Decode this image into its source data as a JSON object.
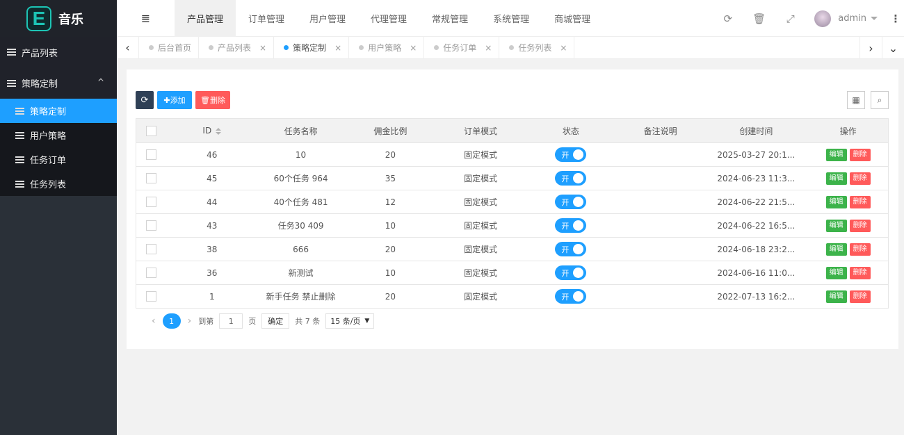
{
  "logo": {
    "letter": "E",
    "title": "音乐"
  },
  "sidebar": {
    "items": [
      {
        "label": "产品列表"
      },
      {
        "label": "策略定制",
        "caret": "^"
      }
    ],
    "sub": [
      {
        "label": "策略定制",
        "active": true
      },
      {
        "label": "用户策略"
      },
      {
        "label": "任务订单"
      },
      {
        "label": "任务列表"
      }
    ]
  },
  "topnav": {
    "menu_icon": "≣",
    "tabs": [
      {
        "label": "产品管理",
        "active": true
      },
      {
        "label": "订单管理"
      },
      {
        "label": "用户管理"
      },
      {
        "label": "代理管理"
      },
      {
        "label": "常规管理"
      },
      {
        "label": "系统管理"
      },
      {
        "label": "商城管理"
      }
    ],
    "refresh_icon": "⟳",
    "trash_icon": "🗑",
    "fullscreen_icon": "⤢",
    "user": "admin",
    "more_icon": "⋮"
  },
  "pagetabs": {
    "left_arrow": "‹",
    "right_arrow": "›",
    "down_arrow": "⌄",
    "close": "×",
    "tabs": [
      {
        "label": "后台首页",
        "closable": false
      },
      {
        "label": "产品列表",
        "closable": true
      },
      {
        "label": "策略定制",
        "closable": true,
        "active": true
      },
      {
        "label": "用户策略",
        "closable": true
      },
      {
        "label": "任务订单",
        "closable": true
      },
      {
        "label": "任务列表",
        "closable": true
      }
    ]
  },
  "toolbar": {
    "refresh": "⟳",
    "add": "✚添加",
    "delete": "🗑删除",
    "cols_icon": "▦",
    "search_icon": "⌕"
  },
  "table": {
    "headers": [
      "ID",
      "任务名称",
      "佣金比例",
      "订单模式",
      "状态",
      "备注说明",
      "创建时间",
      "操作"
    ],
    "switch_label": "开",
    "edit_label": "编辑",
    "delete_label": "删除",
    "rows": [
      {
        "id": "46",
        "name": "10",
        "ratio": "20",
        "mode": "固定模式",
        "note": "",
        "time": "2025-03-27 20:1..."
      },
      {
        "id": "45",
        "name": "60个任务 964",
        "ratio": "35",
        "mode": "固定模式",
        "note": "",
        "time": "2024-06-23 11:3..."
      },
      {
        "id": "44",
        "name": "40个任务 481",
        "ratio": "12",
        "mode": "固定模式",
        "note": "",
        "time": "2024-06-22 21:5..."
      },
      {
        "id": "43",
        "name": "任务30 409",
        "ratio": "10",
        "mode": "固定模式",
        "note": "",
        "time": "2024-06-22 16:5..."
      },
      {
        "id": "38",
        "name": "666",
        "ratio": "20",
        "mode": "固定模式",
        "note": "",
        "time": "2024-06-18 23:2..."
      },
      {
        "id": "36",
        "name": "新测试",
        "ratio": "10",
        "mode": "固定模式",
        "note": "",
        "time": "2024-06-16 11:0..."
      },
      {
        "id": "1",
        "name": "新手任务 禁止删除",
        "ratio": "20",
        "mode": "固定模式",
        "note": "",
        "time": "2022-07-13 16:2..."
      }
    ]
  },
  "pager": {
    "prev": "‹",
    "next": "›",
    "current": "1",
    "goto_label": "到第",
    "page_value": "1",
    "page_unit": "页",
    "go_label": "确定",
    "total": "共 7 条",
    "per_page": "15 条/页"
  }
}
